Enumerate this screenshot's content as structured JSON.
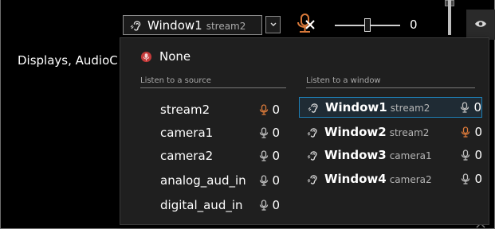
{
  "toolbar": {
    "selected_window": "Window1",
    "selected_stream": "stream2",
    "volume_value": "0",
    "volume_level": 0.5
  },
  "background": {
    "displays_label": "Displays, AudioC"
  },
  "dropdown": {
    "none_label": "None",
    "sources_header": "Listen to a source",
    "windows_header": "Listen to a window",
    "sources": [
      {
        "name": "stream2",
        "level": "0",
        "muted": true
      },
      {
        "name": "camera1",
        "level": "0",
        "muted": false
      },
      {
        "name": "camera2",
        "level": "0",
        "muted": false
      },
      {
        "name": "analog_aud_in",
        "level": "0",
        "muted": false
      },
      {
        "name": "digital_aud_in",
        "level": "0",
        "muted": false
      }
    ],
    "windows": [
      {
        "name": "Window1",
        "stream": "stream2",
        "level": "0",
        "selected": true,
        "muted": false
      },
      {
        "name": "Window2",
        "stream": "stream2",
        "level": "0",
        "selected": false,
        "muted": true
      },
      {
        "name": "Window3",
        "stream": "camera1",
        "level": "0",
        "selected": false,
        "muted": false
      },
      {
        "name": "Window4",
        "stream": "camera2",
        "level": "0",
        "selected": false,
        "muted": false
      }
    ]
  },
  "colors": {
    "accent_orange": "#d9793a",
    "muted_red": "#c43a3a",
    "selection_blue": "#1e7fb6"
  },
  "icons": {
    "ear": "ear-icon",
    "mic": "mic-icon",
    "mic_muted": "mic-muted-icon",
    "none": "none-icon",
    "eye": "eye-icon",
    "chevron": "chevron-down-icon"
  }
}
